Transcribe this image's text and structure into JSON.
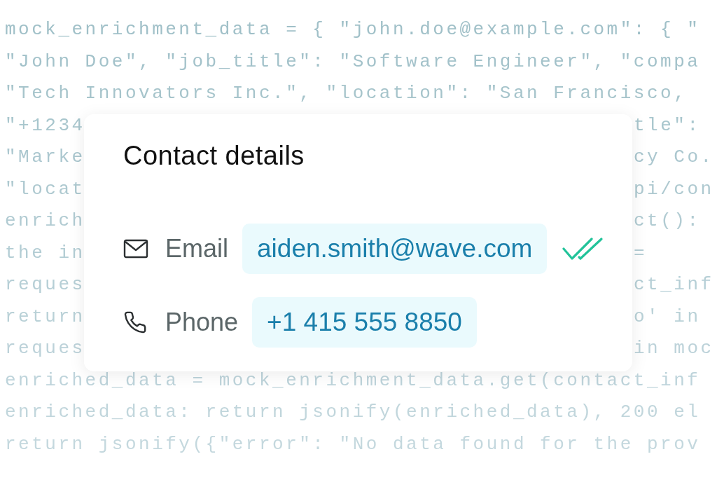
{
  "code_lines": [
    {
      "text": "mock_enrichment_data = { \"john.doe@example.com\": { \""
    },
    {
      "text": "\"John Doe\", \"job_title\": \"Software Engineer\", \"compa"
    },
    {
      "text": "\"Tech Innovators Inc.\", \"location\": \"San Francisco,"
    },
    {
      "text": "\"+1234",
      "right": "tle\":"
    },
    {
      "text": "\"Marke",
      "right": "cy Co."
    },
    {
      "text": "\"locat",
      "right": "pi/con"
    },
    {
      "text": "enrich",
      "right": "ct():"
    },
    {
      "text": "the in",
      "right": "="
    },
    {
      "text": "reques",
      "right": "ct_inf"
    },
    {
      "text": "return",
      "right": "o' in"
    },
    {
      "text": "reques",
      "right": "in moc"
    },
    {
      "text": "enriched_data = mock_enrichment_data.get(contact_inf"
    },
    {
      "text": "enriched_data: return jsonify(enriched_data), 200 el"
    },
    {
      "text": "return jsonify({\"error\": \"No data found for the prov"
    }
  ],
  "card": {
    "title": "Contact details",
    "fields": [
      {
        "kind": "email",
        "label": "Email",
        "value": "aiden.smith@wave.com",
        "verified": true
      },
      {
        "kind": "phone",
        "label": "Phone",
        "value": "+1 415 555 8850",
        "verified": false
      }
    ]
  }
}
